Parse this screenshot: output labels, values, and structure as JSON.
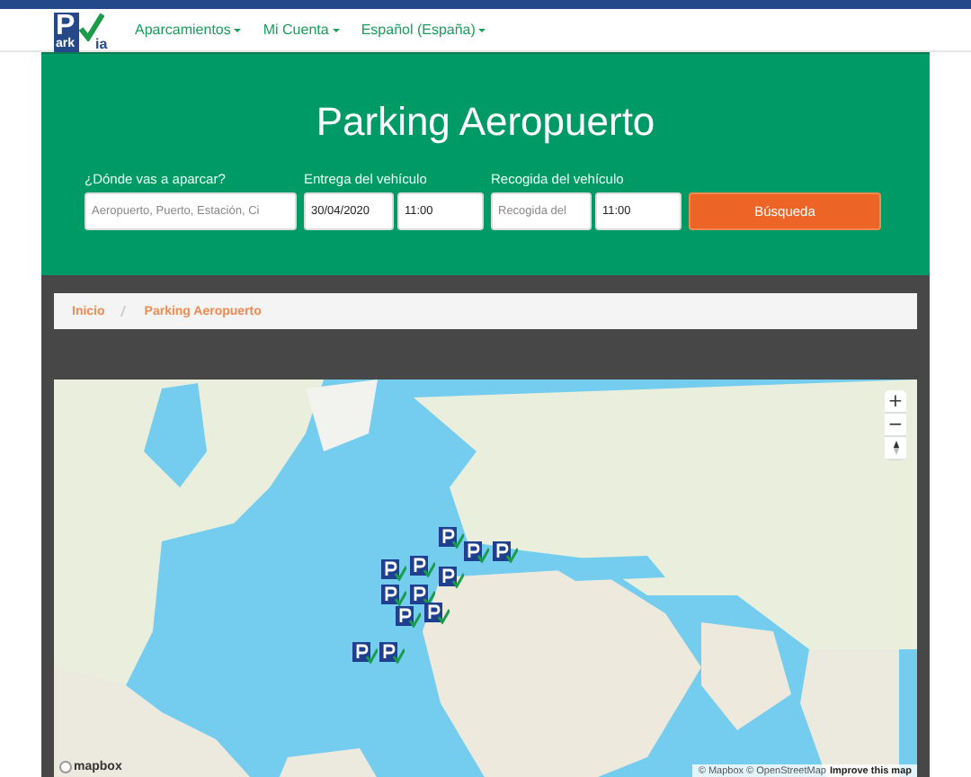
{
  "nav": {
    "logo": {
      "letters_top": "P",
      "letters_bottom_left": "ark",
      "letters_bottom_right": "ia"
    },
    "menus": [
      {
        "label": "Aparcamientos"
      },
      {
        "label": "Mi Cuenta"
      },
      {
        "label": "Español (España)"
      }
    ]
  },
  "hero": {
    "title": "Parking Aeropuerto",
    "groups": [
      {
        "label": "¿Dónde vas a aparcar?",
        "fields": [
          {
            "placeholder": "Aeropuerto, Puerto, Estación, Ci"
          }
        ]
      },
      {
        "label": "Entrega del vehículo",
        "fields": [
          {
            "value": "30/04/2020"
          },
          {
            "value": "11:00"
          }
        ]
      },
      {
        "label": "Recogida del vehículo",
        "fields": [
          {
            "placeholder": "Recogida del"
          },
          {
            "value": "11:00"
          }
        ]
      }
    ],
    "button": "Búsqueda"
  },
  "breadcrumb": [
    {
      "label": "Inicio"
    },
    {
      "label": "Parking Aeropuerto"
    }
  ],
  "map": {
    "controls": [
      "+",
      "−"
    ],
    "logo": "mapbox",
    "attribution": "© Mapbox © OpenStreetMap",
    "improve_link": "Improve this map"
  }
}
